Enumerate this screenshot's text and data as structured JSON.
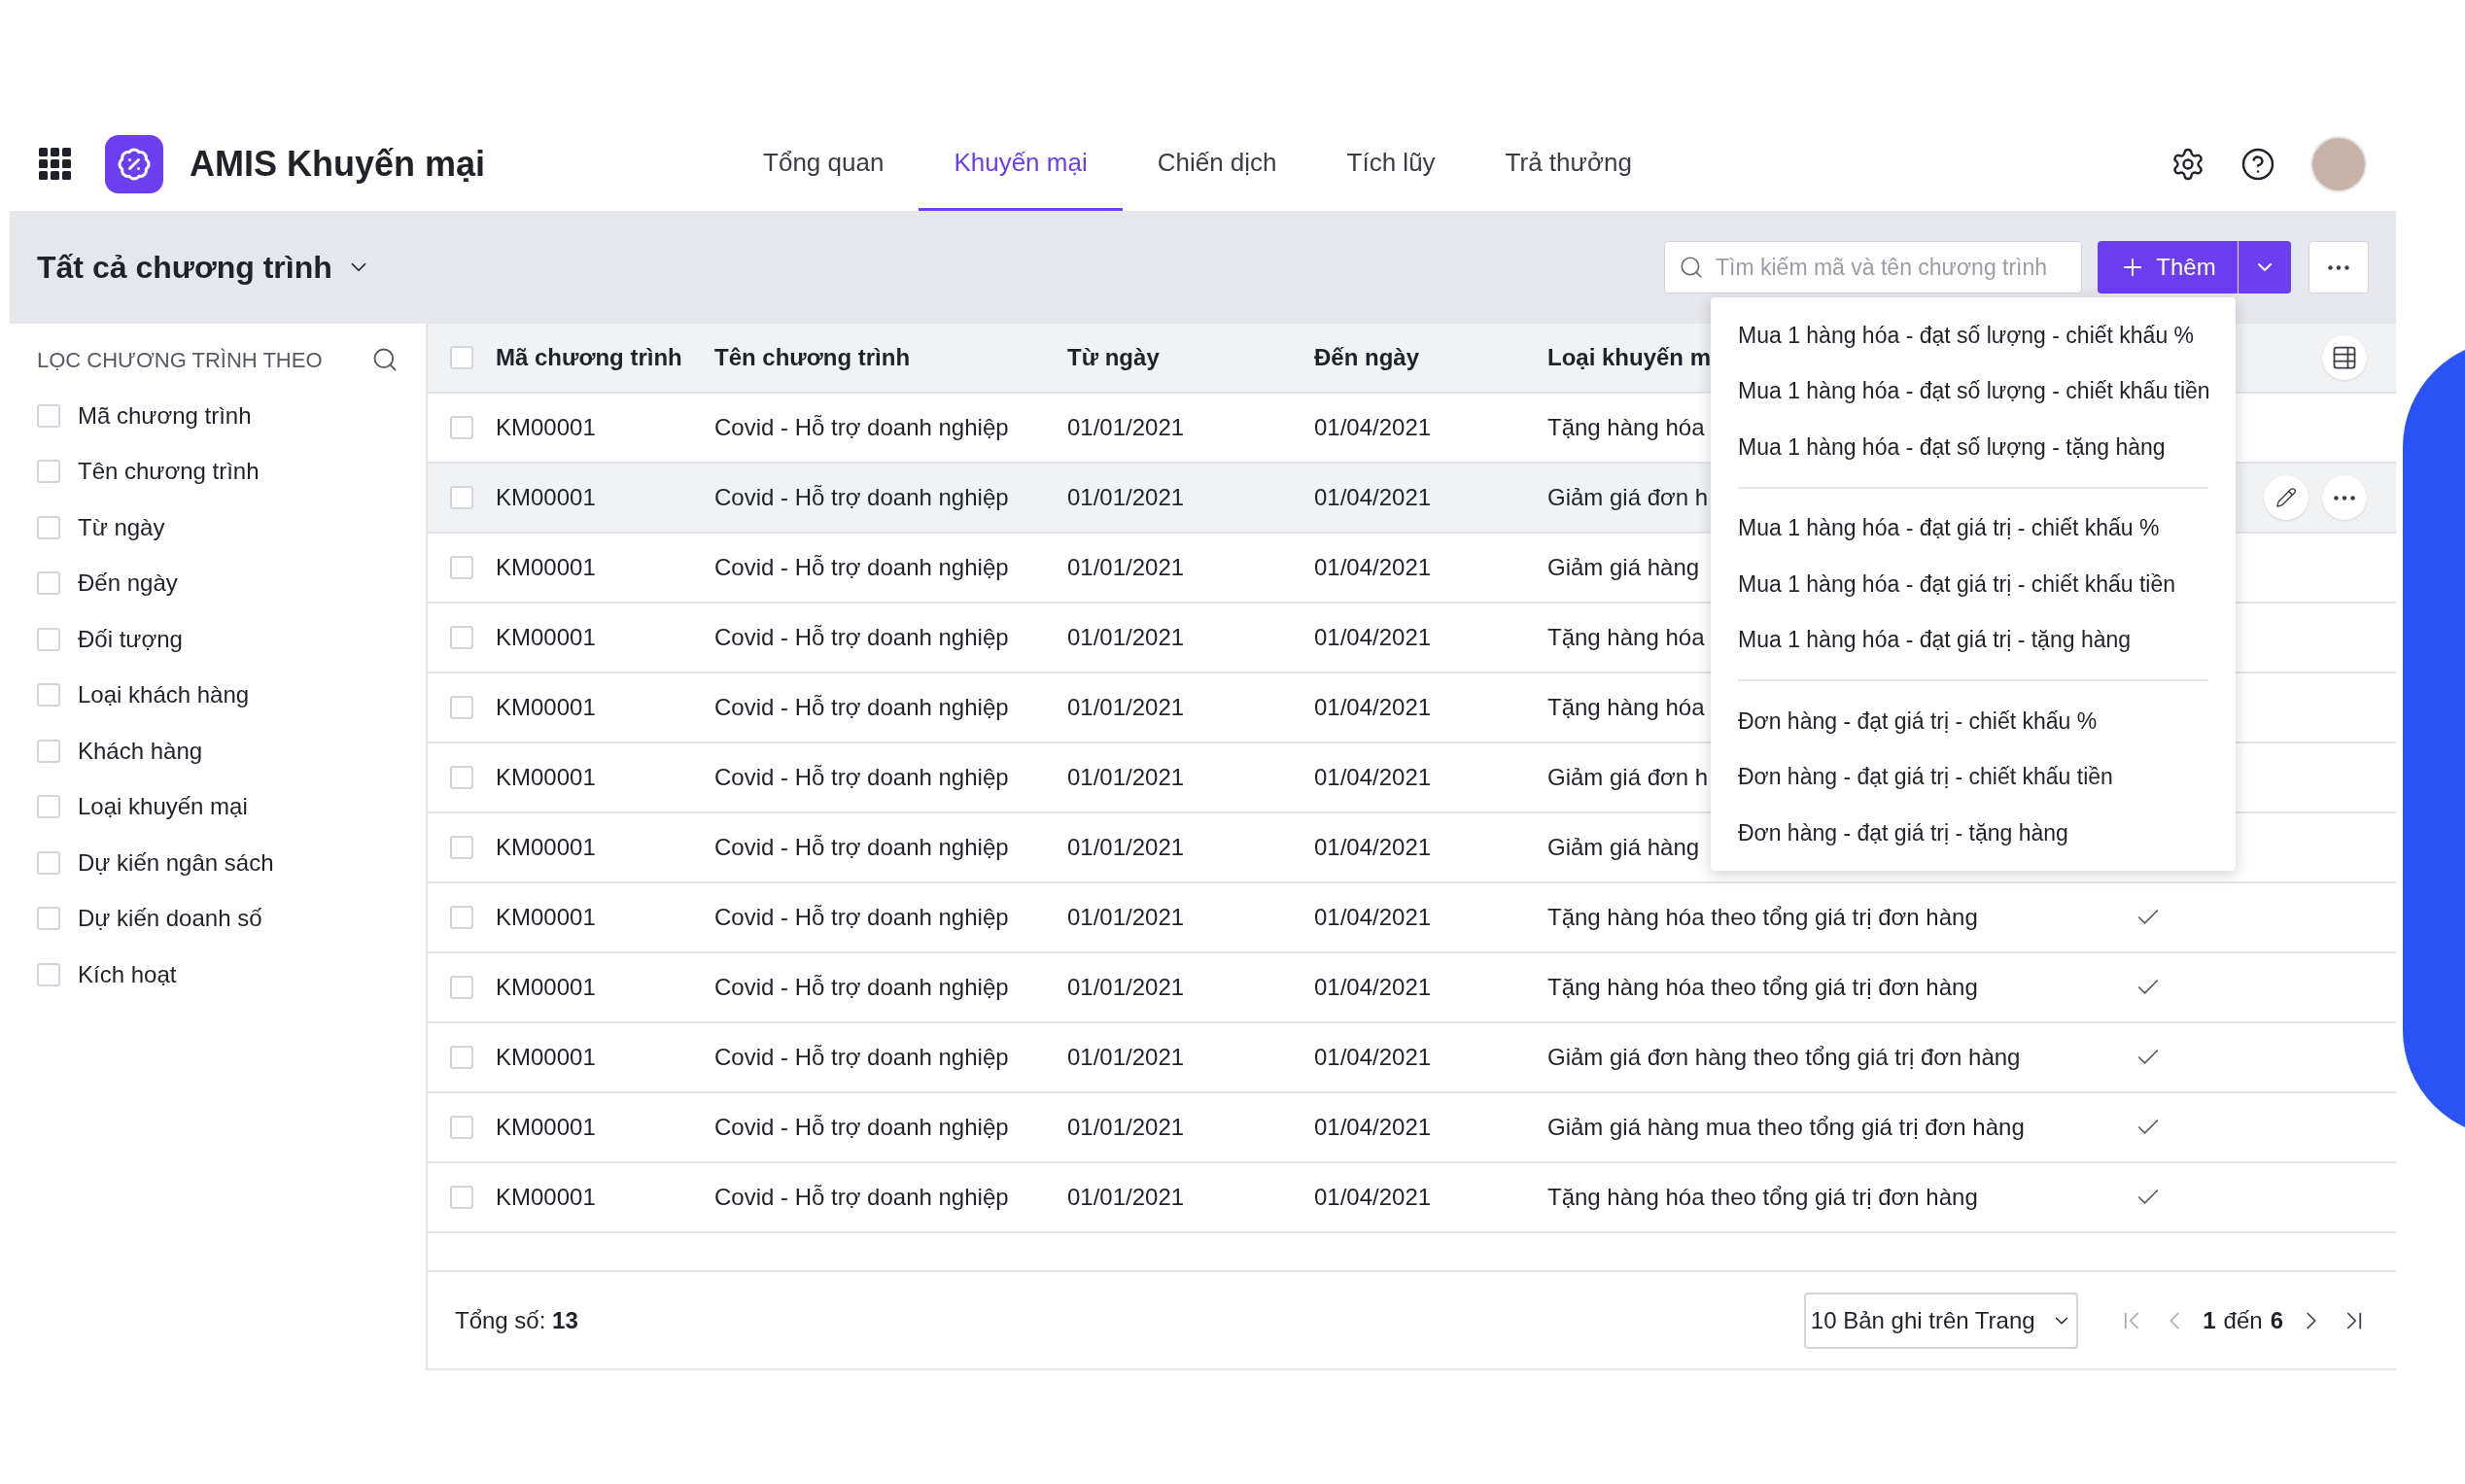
{
  "app": {
    "title": "AMIS Khuyến mại"
  },
  "nav_tabs": [
    {
      "label": "Tổng quan",
      "selected": false
    },
    {
      "label": "Khuyến mại",
      "selected": true
    },
    {
      "label": "Chiến dịch",
      "selected": false
    },
    {
      "label": "Tích lũy",
      "selected": false
    },
    {
      "label": "Trả thưởng",
      "selected": false
    }
  ],
  "toolbar": {
    "view_title": "Tất cả chương trình",
    "search": {
      "placeholder": "Tìm kiếm mã và tên chương trình"
    },
    "add_button": "Thêm"
  },
  "filter_panel": {
    "heading": "LỌC CHƯƠNG TRÌNH THEO",
    "items": [
      {
        "label": "Mã chương trình",
        "checked": false
      },
      {
        "label": "Tên chương trình",
        "checked": false
      },
      {
        "label": "Từ ngày",
        "checked": false
      },
      {
        "label": "Đến ngày",
        "checked": false
      },
      {
        "label": "Đối tượng",
        "checked": false
      },
      {
        "label": "Loại khách hàng",
        "checked": false
      },
      {
        "label": "Khách hàng",
        "checked": false
      },
      {
        "label": "Loại khuyến mại",
        "checked": false
      },
      {
        "label": "Dự kiến ngân sách",
        "checked": false
      },
      {
        "label": "Dự kiến doanh số",
        "checked": false
      },
      {
        "label": "Kích hoạt",
        "checked": false
      }
    ]
  },
  "table": {
    "select_all": {
      "checked": false
    },
    "columns": [
      "Mã chương trình",
      "Tên chương trình",
      "Từ ngày",
      "Đến ngày",
      "Loại khuyến m"
    ],
    "rows": [
      {
        "checked": false,
        "highlighted": false,
        "cells": [
          "KM00001",
          "Covid - Hỗ trợ doanh nghiệp",
          "01/01/2021",
          "01/04/2021",
          "Tặng hàng hóa"
        ]
      },
      {
        "checked": false,
        "highlighted": true,
        "cells": [
          "KM00001",
          "Covid - Hỗ trợ doanh nghiệp",
          "01/01/2021",
          "01/04/2021",
          "Giảm giá đơn h"
        ]
      },
      {
        "checked": false,
        "highlighted": false,
        "cells": [
          "KM00001",
          "Covid - Hỗ trợ doanh nghiệp",
          "01/01/2021",
          "01/04/2021",
          "Giảm giá hàng"
        ]
      },
      {
        "checked": false,
        "highlighted": false,
        "cells": [
          "KM00001",
          "Covid - Hỗ trợ doanh nghiệp",
          "01/01/2021",
          "01/04/2021",
          "Tặng hàng hóa"
        ]
      },
      {
        "checked": false,
        "highlighted": false,
        "cells": [
          "KM00001",
          "Covid - Hỗ trợ doanh nghiệp",
          "01/01/2021",
          "01/04/2021",
          "Tặng hàng hóa"
        ]
      },
      {
        "checked": false,
        "highlighted": false,
        "cells": [
          "KM00001",
          "Covid - Hỗ trợ doanh nghiệp",
          "01/01/2021",
          "01/04/2021",
          "Giảm giá đơn h"
        ]
      },
      {
        "checked": false,
        "highlighted": false,
        "cells": [
          "KM00001",
          "Covid - Hỗ trợ doanh nghiệp",
          "01/01/2021",
          "01/04/2021",
          "Giảm giá hàng"
        ]
      },
      {
        "checked": false,
        "highlighted": false,
        "active": true,
        "cells": [
          "KM00001",
          "Covid - Hỗ trợ doanh nghiệp",
          "01/01/2021",
          "01/04/2021",
          "Tặng hàng hóa theo tổng giá trị đơn hàng"
        ]
      },
      {
        "checked": false,
        "highlighted": false,
        "active": true,
        "cells": [
          "KM00001",
          "Covid - Hỗ trợ doanh nghiệp",
          "01/01/2021",
          "01/04/2021",
          "Tặng hàng hóa theo tổng giá trị đơn hàng"
        ]
      },
      {
        "checked": false,
        "highlighted": false,
        "active": true,
        "cells": [
          "KM00001",
          "Covid - Hỗ trợ doanh nghiệp",
          "01/01/2021",
          "01/04/2021",
          "Giảm giá đơn hàng theo tổng giá trị đơn hàng"
        ]
      },
      {
        "checked": false,
        "highlighted": false,
        "active": true,
        "cells": [
          "KM00001",
          "Covid - Hỗ trợ doanh nghiệp",
          "01/01/2021",
          "01/04/2021",
          "Giảm giá hàng mua theo tổng giá trị đơn hàng"
        ]
      },
      {
        "checked": false,
        "highlighted": false,
        "active": true,
        "cells": [
          "KM00001",
          "Covid - Hỗ trợ doanh nghiệp",
          "01/01/2021",
          "01/04/2021",
          "Tặng hàng hóa theo tổng giá trị đơn hàng"
        ]
      }
    ]
  },
  "add_menu": {
    "groups": [
      {
        "items": [
          "Mua 1 hàng hóa - đạt số lượng - chiết khấu %",
          "Mua 1 hàng hóa - đạt số lượng - chiết khấu tiền",
          "Mua 1 hàng hóa - đạt số lượng - tặng hàng"
        ]
      },
      {
        "items": [
          "Mua 1 hàng hóa - đạt giá trị - chiết khấu %",
          "Mua 1 hàng hóa - đạt giá trị - chiết khấu tiền",
          "Mua 1 hàng hóa - đạt giá trị - tặng hàng"
        ]
      },
      {
        "items": [
          "Đơn hàng - đạt giá trị - chiết khấu %",
          "Đơn hàng - đạt giá trị - chiết khấu tiền",
          "Đơn hàng - đạt giá trị - tặng hàng"
        ]
      }
    ]
  },
  "footer": {
    "total": "Tổng số: **13**",
    "page_size": "10 Bản ghi trên Trang",
    "page_from": "1",
    "page_sep": "đến",
    "page_to": "6"
  }
}
